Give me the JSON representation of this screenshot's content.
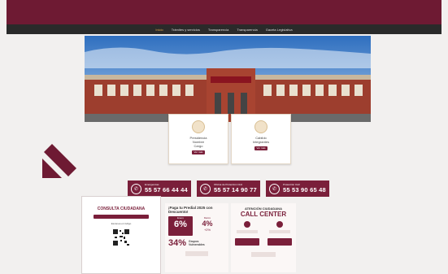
{
  "nav": {
    "items": [
      "Inicio",
      "Trámites y servicios",
      "Transparencia",
      "Transparencia",
      "Gaceta Legislativa"
    ]
  },
  "cards": [
    {
      "title": "Presidencia",
      "line1": "Nombre",
      "line2": "Cargo",
      "button": "Ver más"
    },
    {
      "title": "Cabildo",
      "line1": "Integrantes",
      "line2": "",
      "button": "Ver más"
    }
  ],
  "phones": [
    {
      "label": "Emergencias",
      "number": "55 57 66 44 44"
    },
    {
      "label": "Oficina de Protección Civil",
      "number": "55 57 14 90 77"
    },
    {
      "label": "Protección Civil",
      "number": "55 53 90 65 48"
    }
  ],
  "consulta": {
    "title": "CONSULTA CIUDADANA",
    "sub": "Escanea el código"
  },
  "predial": {
    "title": "¡Paga tu Predial 2025 con Descuento!",
    "jan": "Enero",
    "jan_pct": "6%",
    "mar": "Marzo",
    "mar_pct": "4%",
    "extra": "+2%",
    "group": "34%",
    "group_label": "Grupos Vulnerables"
  },
  "callcenter": {
    "title": "ATENCIÓN CIUDADANA",
    "big": "CALL CENTER"
  },
  "colors": {
    "maroon": "#6e1a33",
    "accent": "#7a1f3a",
    "gold": "#d9a34a"
  }
}
